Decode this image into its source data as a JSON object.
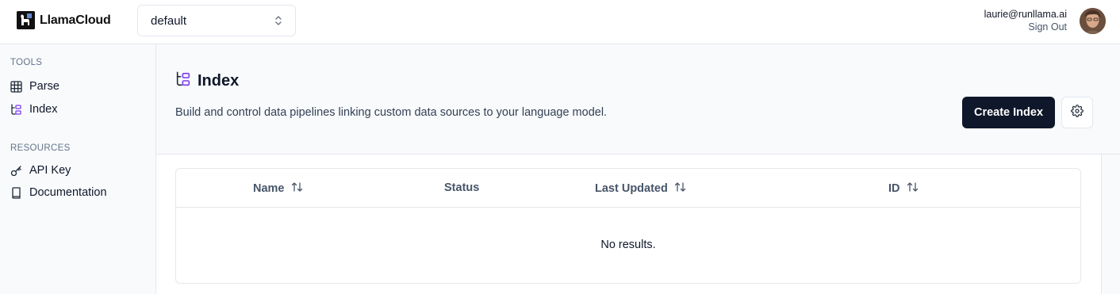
{
  "header": {
    "logo_text": "LlamaCloud",
    "project_select_value": "default",
    "user_email": "laurie@runllama.ai",
    "sign_out_label": "Sign Out"
  },
  "sidebar": {
    "tools_label": "TOOLS",
    "tools": [
      {
        "label": "Parse",
        "icon": "table-grid-icon"
      },
      {
        "label": "Index",
        "icon": "index-tree-icon"
      }
    ],
    "resources_label": "RESOURCES",
    "resources": [
      {
        "label": "API Key",
        "icon": "key-icon"
      },
      {
        "label": "Documentation",
        "icon": "book-icon"
      }
    ]
  },
  "main": {
    "title": "Index",
    "subtitle": "Build and control data pipelines linking custom data sources to your language model.",
    "create_button_label": "Create Index",
    "settings_icon": "gear-icon",
    "table": {
      "columns": [
        {
          "label": "Name",
          "sortable": true
        },
        {
          "label": "Status",
          "sortable": false
        },
        {
          "label": "Last Updated",
          "sortable": true
        },
        {
          "label": "ID",
          "sortable": true
        }
      ],
      "empty_text": "No results."
    }
  },
  "colors": {
    "accent_purple": "#7c3aed",
    "primary_button": "#0f172a",
    "sidebar_bg": "#f8fafc"
  }
}
